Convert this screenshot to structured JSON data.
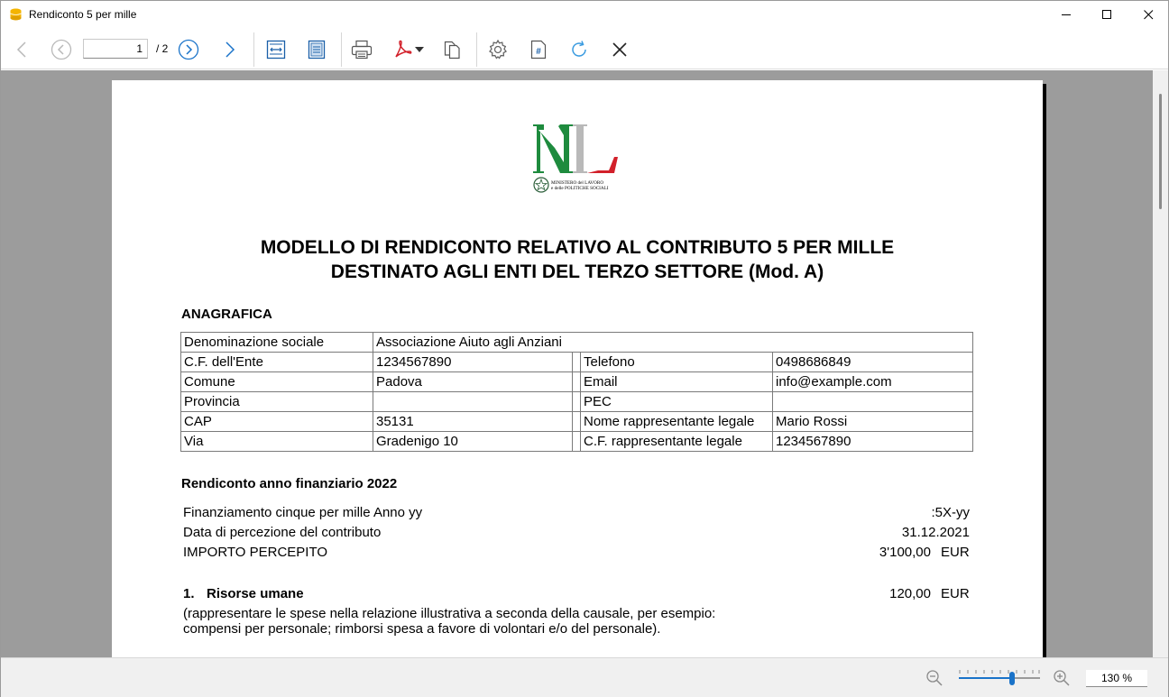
{
  "window": {
    "title": "Rendiconto 5 per mille",
    "app_icon": "database-icon"
  },
  "toolbar": {
    "current_page": "1",
    "total_pages": "/ 2",
    "icons": [
      "arrow-left-icon",
      "circle-chevron-left-icon",
      "circle-chevron-right-icon",
      "arrow-right-icon",
      "fit-width-icon",
      "fit-page-icon",
      "print-icon",
      "pdf-icon",
      "copy-icon",
      "settings-icon",
      "page-number-icon",
      "refresh-icon",
      "close-icon"
    ]
  },
  "document": {
    "logo_text_line1": "MINISTERO del LAVORO",
    "logo_text_line2": "e delle POLITICHE SOCIALI",
    "title_line1": "MODELLO DI RENDICONTO RELATIVO AL CONTRIBUTO 5 PER MILLE",
    "title_line2": "DESTINATO AGLI ENTI DEL TERZO SETTORE (Mod. A)",
    "anagrafica_heading": "ANAGRAFICA",
    "anagrafica": {
      "denominazione_label": "Denominazione sociale",
      "denominazione_value": "Associazione Aiuto agli Anziani",
      "rows": [
        {
          "l1": "C.F. dell'Ente",
          "v1": "1234567890",
          "l2": "Telefono",
          "v2": "0498686849"
        },
        {
          "l1": "Comune",
          "v1": "Padova",
          "l2": "Email",
          "v2": "info@example.com"
        },
        {
          "l1": "Provincia",
          "v1": "",
          "l2": "PEC",
          "v2": ""
        },
        {
          "l1": "CAP",
          "v1": "35131",
          "l2": "Nome rappresentante legale",
          "v2": "Mario Rossi"
        },
        {
          "l1": "Via",
          "v1": "Gradenigo 10",
          "l2": "C.F. rappresentante legale",
          "v2": "1234567890"
        }
      ]
    },
    "rendiconto_heading": "Rendiconto anno finanziario 2022",
    "finanziamento_label": "Finanziamento cinque per mille Anno yy",
    "finanziamento_value": ":5X-yy",
    "data_percezione_label": "Data di percezione del contributo",
    "data_percezione_value": "31.12.2021",
    "importo_label": "IMPORTO PERCEPITO",
    "importo_value": "3'100,00",
    "importo_currency": "EUR",
    "risorse_number": "1.",
    "risorse_label": "Risorse umane",
    "risorse_value": "120,00",
    "risorse_currency": "EUR",
    "risorse_note_line1": "(rappresentare le spese nella relazione illustrativa a seconda della causale, per esempio:",
    "risorse_note_line2": "compensi per personale; rimborsi spesa a favore di volontari e/o del personale)."
  },
  "statusbar": {
    "zoom_label": "130 %",
    "zoom_level": 0.65
  },
  "colors": {
    "accent": "#1a73c9",
    "viewer_bg": "#9c9c9c",
    "logo_green": "#1e8b3e",
    "logo_red": "#d2202a",
    "logo_grey": "#b9b9b9"
  }
}
